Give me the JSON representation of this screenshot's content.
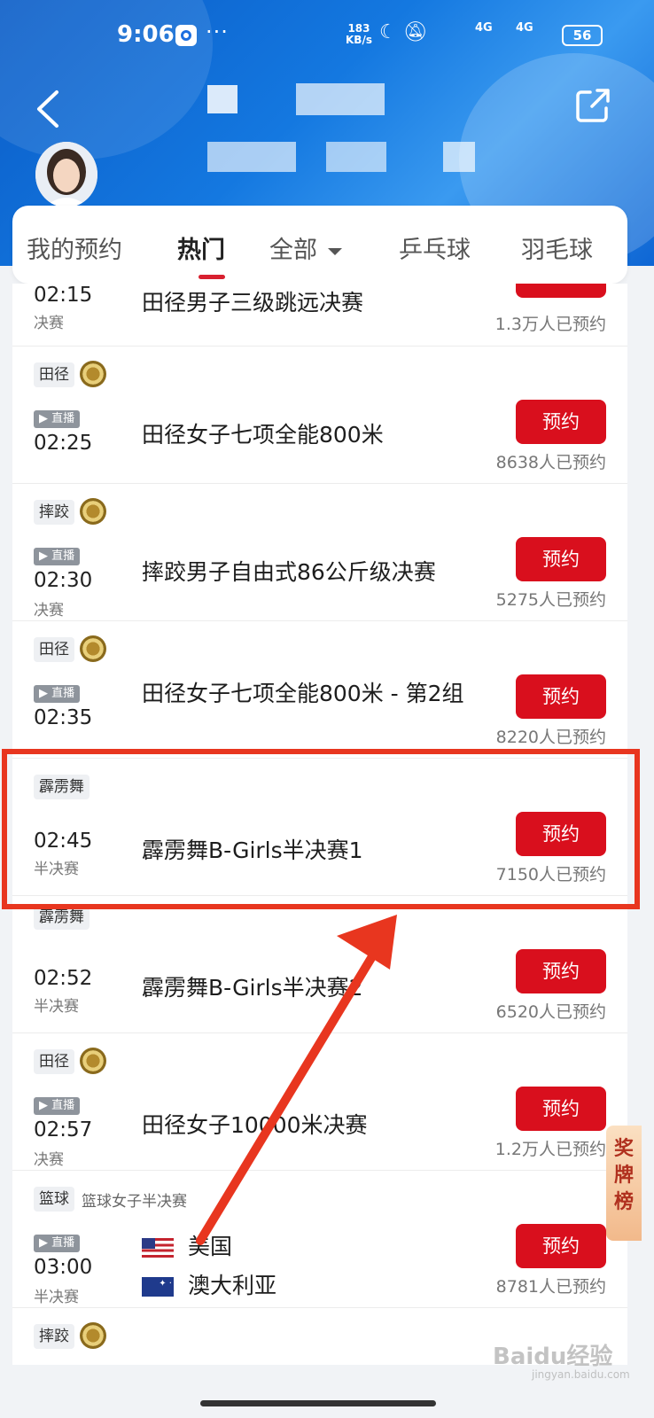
{
  "status_bar": {
    "time": "9:06",
    "more": "···",
    "speed_value": "183",
    "speed_unit": "KB/s",
    "network1": "4G",
    "network2": "4G",
    "battery": "56"
  },
  "tabs": [
    {
      "label": "我的预约",
      "active": false
    },
    {
      "label": "热门",
      "active": true
    },
    {
      "label": "全部",
      "active": false,
      "dropdown": true
    },
    {
      "label": "乒乓球",
      "active": false
    },
    {
      "label": "羽毛球",
      "active": false
    }
  ],
  "events": [
    {
      "time": "02:15",
      "stage": "决赛",
      "name": "田径男子三级跳远决赛",
      "count": "1.3万人已预约"
    },
    {
      "sport": "田径",
      "medal": true,
      "live": "直播",
      "time": "02:25",
      "stage": "",
      "name": "田径女子七项全能800米",
      "button": "预约",
      "count": "8638人已预约"
    },
    {
      "sport": "摔跤",
      "medal": true,
      "live": "直播",
      "time": "02:30",
      "stage": "决赛",
      "name": "摔跤男子自由式86公斤级决赛",
      "button": "预约",
      "count": "5275人已预约"
    },
    {
      "sport": "田径",
      "medal": true,
      "live": "直播",
      "time": "02:35",
      "stage": "",
      "name": "田径女子七项全能800米 - 第2组",
      "button": "预约",
      "count": "8220人已预约"
    },
    {
      "sport": "霹雳舞",
      "medal": false,
      "time": "02:45",
      "stage": "半决赛",
      "name": "霹雳舞B-Girls半决赛1",
      "button": "预约",
      "count": "7150人已预约"
    },
    {
      "sport": "霹雳舞",
      "medal": false,
      "time": "02:52",
      "stage": "半决赛",
      "name": "霹雳舞B-Girls半决赛2",
      "button": "预约",
      "count": "6520人已预约"
    },
    {
      "sport": "田径",
      "medal": true,
      "live": "直播",
      "time": "02:57",
      "stage": "决赛",
      "name": "田径女子10000米决赛",
      "button": "预约",
      "count": "1.2万人已预约"
    },
    {
      "sport": "篮球",
      "subtitle": "篮球女子半决赛",
      "live": "直播",
      "time": "03:00",
      "stage": "半决赛",
      "team1": "美国",
      "team2": "澳大利亚",
      "button": "预约",
      "count": "8781人已预约"
    },
    {
      "sport": "摔跤",
      "medal": true
    }
  ],
  "medal_rank_label": "奖牌榜",
  "watermark": "Baidu经验",
  "watermark_sub": "jingyan.baidu.com",
  "colors": {
    "accent": "#d90f1d",
    "highlight": "#e8361f",
    "header": "#1478e0"
  }
}
